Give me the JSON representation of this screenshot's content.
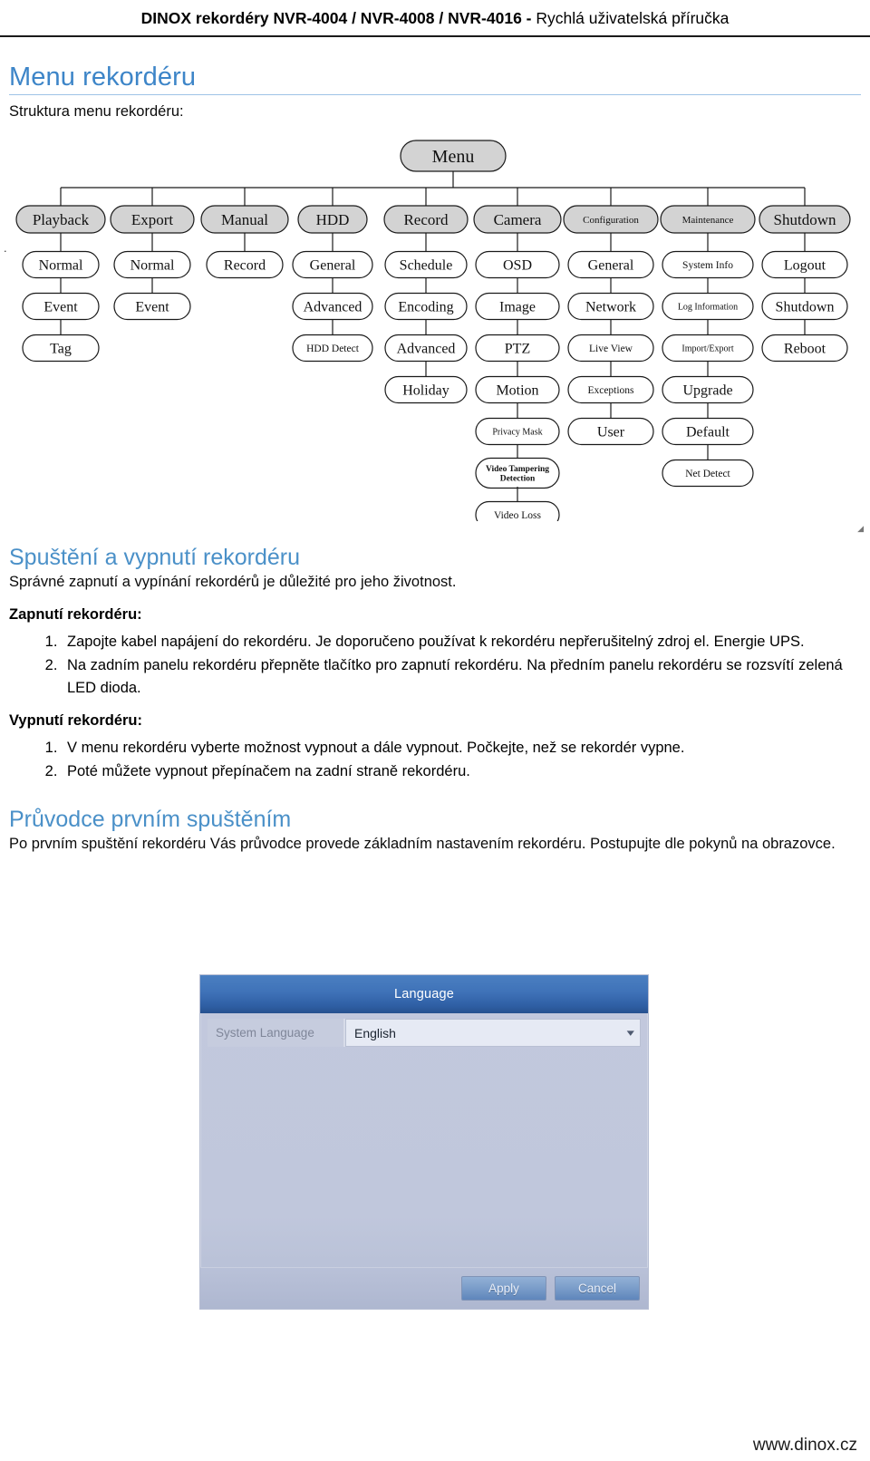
{
  "header": {
    "bold_part": "DINOX rekordéry NVR-4004 / NVR-4008 / NVR-4016 -",
    "regular_part": " Rychlá uživatelská příručka"
  },
  "accent_colors": {
    "heading_blue": "#3d85c8",
    "rule_blue": "#9ec3e6",
    "dialog_title_blue": "#3f72b8"
  },
  "sections": {
    "menu": {
      "title": "Menu rekordéru",
      "intro": "Struktura menu rekordéru:"
    },
    "power": {
      "title": "Spuštění a vypnutí rekordéru",
      "intro": "Správné zapnutí a vypínání rekordérů je důležité pro jeho životnost.",
      "power_on_heading": "Zapnutí rekordéru:",
      "power_on_steps": [
        "Zapojte kabel napájení do rekordéru. Je doporučeno používat k rekordéru nepřerušitelný zdroj el. Energie UPS.",
        "Na zadním panelu rekordéru přepněte tlačítko pro zapnutí rekordéru. Na předním panelu rekordéru se rozsvítí zelená LED dioda."
      ],
      "power_off_heading": "Vypnutí rekordéru:",
      "power_off_steps": [
        "V menu rekordéru vyberte možnost vypnout a dále vypnout. Počkejte, než se rekordér vypne.",
        "Poté můžete vypnout přepínačem na zadní straně rekordéru."
      ]
    },
    "wizard": {
      "title": "Průvodce prvním spuštěním",
      "text": "Po prvním spuštění rekordéru Vás průvodce provede základním nastavením rekordéru. Postupujte dle pokynů na obrazovce."
    }
  },
  "menu_tree": {
    "root": "Menu",
    "columns": [
      {
        "top": "Playback",
        "children": [
          "Normal",
          "Event",
          "Tag"
        ]
      },
      {
        "top": "Export",
        "children": [
          "Normal",
          "Event"
        ]
      },
      {
        "top": "Manual",
        "children": [
          "Record"
        ]
      },
      {
        "top": "HDD",
        "children": [
          "General",
          "Advanced",
          "HDD Detect"
        ]
      },
      {
        "top": "Record",
        "children": [
          "Schedule",
          "Encoding",
          "Advanced",
          "Holiday"
        ]
      },
      {
        "top": "Camera",
        "children": [
          "OSD",
          "Image",
          "PTZ",
          "Motion",
          "Privacy Mask",
          "Video Tampering Detection",
          "Video Loss"
        ]
      },
      {
        "top": "Configuration",
        "children": [
          "General",
          "Network",
          "Live View",
          "Exceptions",
          "User"
        ]
      },
      {
        "top": "Maintenance",
        "children": [
          "System Info",
          "Log Information",
          "Import/Export",
          "Upgrade",
          "Default",
          "Net Detect"
        ]
      },
      {
        "top": "Shutdown",
        "children": [
          "Logout",
          "Shutdown",
          "Reboot"
        ]
      }
    ]
  },
  "language_dialog": {
    "title": "Language",
    "field_label": "System Language",
    "field_value": "English",
    "caret_icon": "chevron-down-icon",
    "apply_label": "Apply",
    "cancel_label": "Cancel"
  },
  "footer": {
    "website": "www.dinox.cz"
  },
  "stray_marks": {
    "left_dot": ".",
    "right_tick": "◢"
  }
}
